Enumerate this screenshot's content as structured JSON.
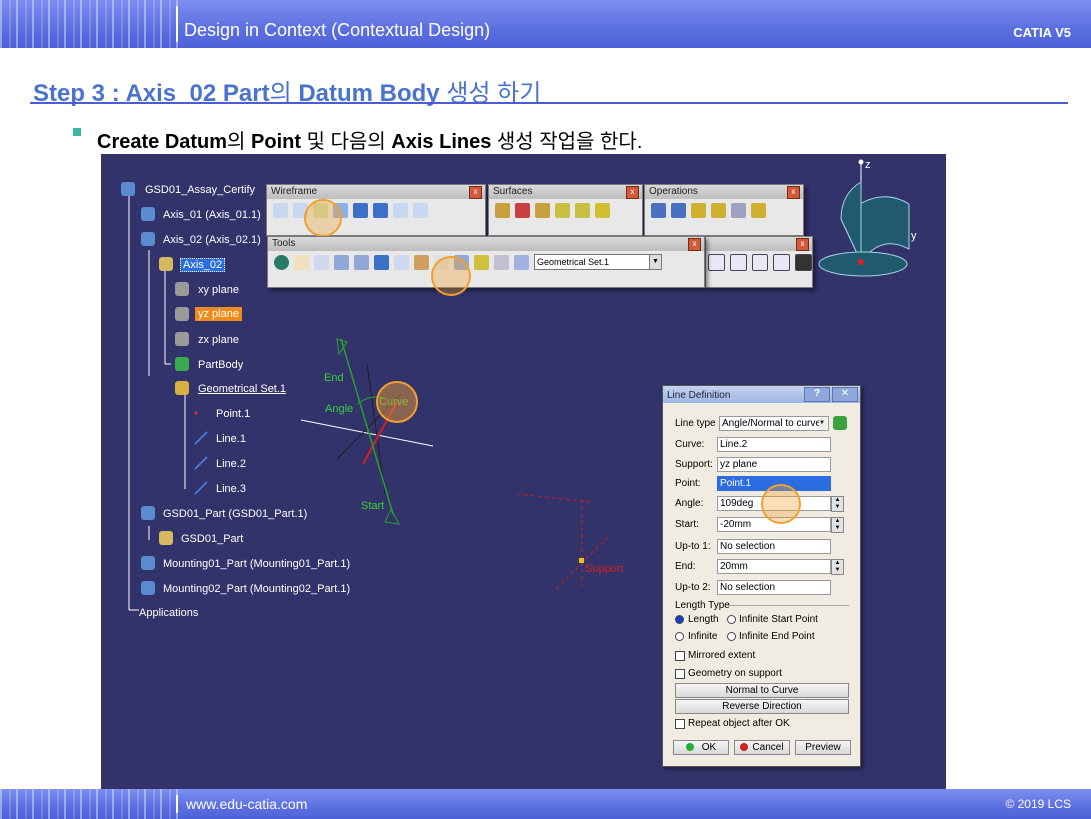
{
  "header": {
    "title": "Design in Context (Contextual Design)",
    "product": "CATIA V5"
  },
  "step": {
    "prefix": "Step 3 : Axis_02 Part",
    "connector": "의 ",
    "bold2": "Datum Body",
    "suffix": " 생성 하기"
  },
  "bullet": {
    "p1": "Create Datum",
    "p2": "의 ",
    "p3": "Point",
    "p4": " 및 다음의 ",
    "p5": "Axis Lines",
    "p6": " 생성 작업을 한다."
  },
  "tree": {
    "root": "GSD01_Assay_Certify",
    "axis01": "Axis_01 (Axis_01.1)",
    "axis02": "Axis_02 (Axis_02.1)",
    "axis02_part": "Axis_02",
    "xy": "xy plane",
    "yz": "yz plane",
    "zx": "zx plane",
    "partbody": "PartBody",
    "geoset": "Geometrical Set.1",
    "point1": "Point.1",
    "line1": "Line.1",
    "line2": "Line.2",
    "line3": "Line.3",
    "gsd01part": "GSD01_Part (GSD01_Part.1)",
    "gsd01": "GSD01_Part",
    "mount01": "Mounting01_Part (Mounting01_Part.1)",
    "mount02": "Mounting02_Part (Mounting02_Part.1)",
    "applications": "Applications"
  },
  "toolbars": {
    "wireframe": "Wireframe",
    "surfaces": "Surfaces",
    "operations": "Operations",
    "tools": "Tools",
    "tools_combo": "Geometrical Set.1"
  },
  "viewport_labels": {
    "end": "End",
    "angle": "Angle",
    "curve": "Curve",
    "start": "Start",
    "support": "Support",
    "z": "z",
    "y": "y"
  },
  "dialog": {
    "title": "Line Definition",
    "help": "?",
    "close": "✕",
    "line_type_label": "Line type",
    "line_type_value": "Angle/Normal to curve",
    "curve_label": "Curve:",
    "curve_value": "Line.2",
    "support_label": "Support:",
    "support_value": "yz plane",
    "point_label": "Point:",
    "point_value": "Point.1",
    "angle_label": "Angle:",
    "angle_value": "109deg",
    "start_label": "Start:",
    "start_value": "-20mm",
    "upto1_label": "Up-to 1:",
    "upto1_value": "No selection",
    "end_label": "End:",
    "end_value": "20mm",
    "upto2_label": "Up-to 2:",
    "upto2_value": "No selection",
    "length_type_label": "Length Type",
    "r_length": "Length",
    "r_inf_start": "Infinite Start Point",
    "r_infinite": "Infinite",
    "r_inf_end": "Infinite End Point",
    "mirrored": "Mirrored extent",
    "geom_support": "Geometry on support",
    "normal_btn": "Normal to Curve",
    "reverse_btn": "Reverse Direction",
    "repeat": "Repeat object after OK",
    "ok": "OK",
    "cancel": "Cancel",
    "preview": "Preview"
  },
  "footer": {
    "url": "www.edu-catia.com",
    "copyright": "© 2019 LCS"
  }
}
